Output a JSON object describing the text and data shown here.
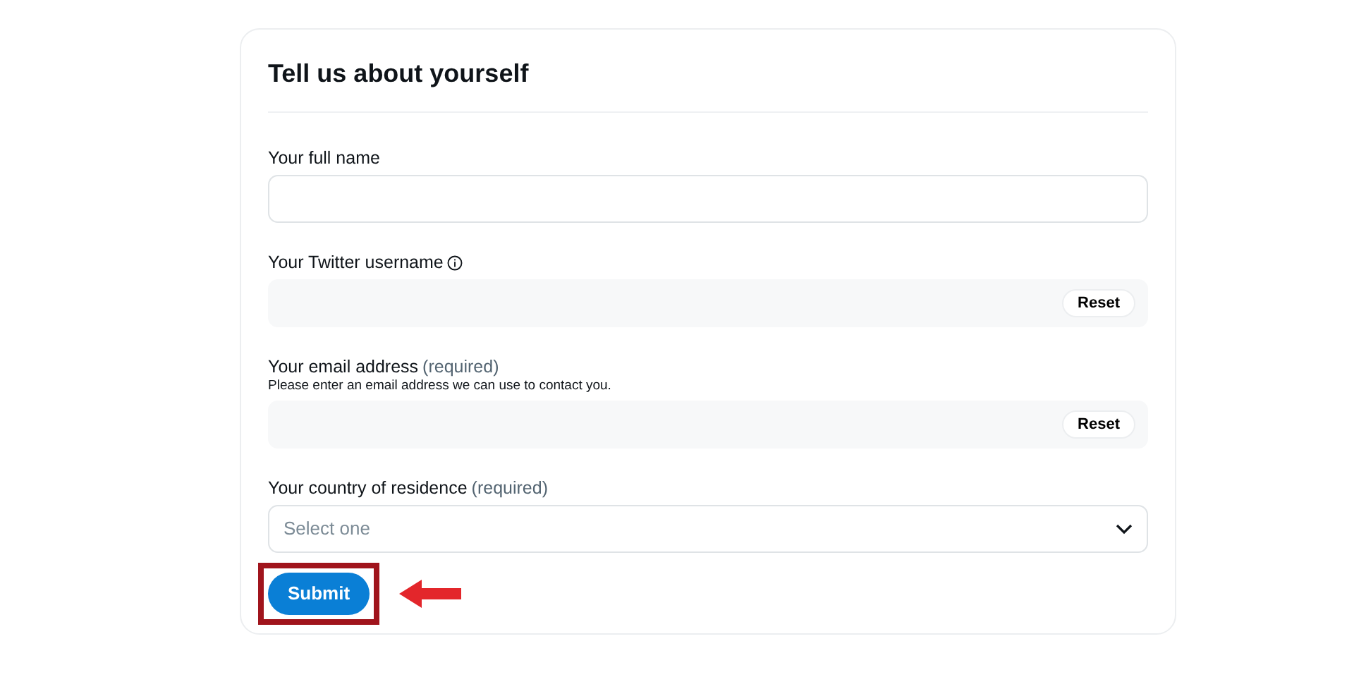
{
  "form": {
    "title": "Tell us about yourself",
    "fields": [
      {
        "kind": "text",
        "label": "Your full name",
        "info": false
      },
      {
        "kind": "reset",
        "label": "Your Twitter username",
        "info": true,
        "button": "Reset"
      },
      {
        "kind": "reset",
        "label": "Your email address",
        "note": "(required)",
        "help": "Please enter an email address we can use to contact you.",
        "info": false,
        "button": "Reset"
      },
      {
        "kind": "select",
        "label": "Your country of residence",
        "note": "(required)",
        "placeholder": "Select one",
        "info": false
      }
    ],
    "submit": {
      "label": "Submit",
      "highlighted": true
    }
  }
}
